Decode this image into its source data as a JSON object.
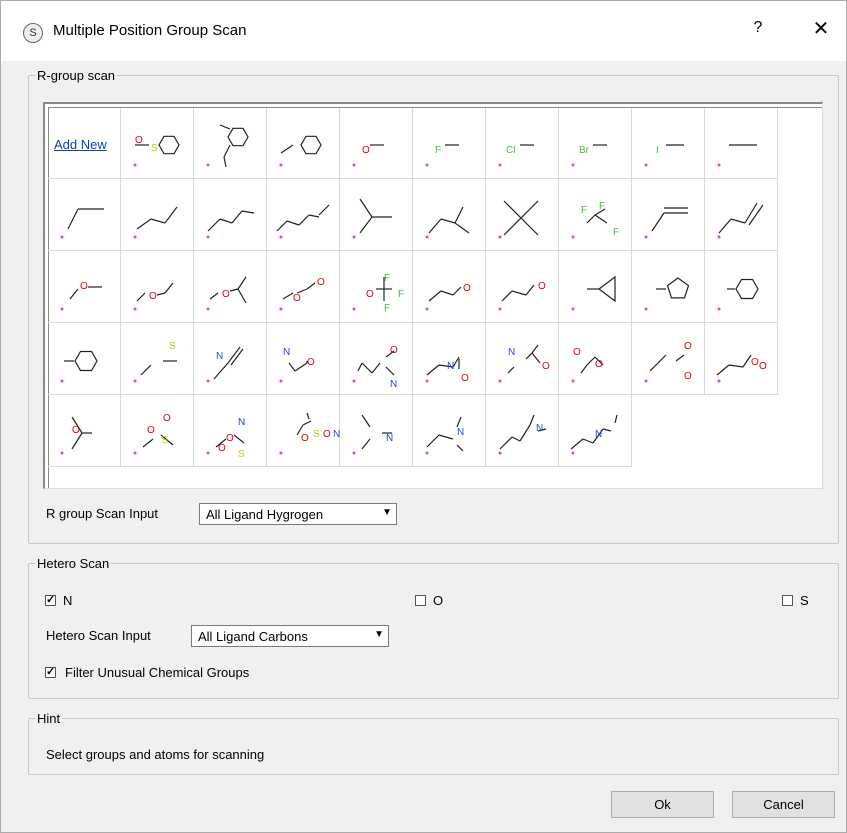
{
  "window": {
    "title": "Multiple Position Group Scan",
    "help": "?",
    "close": "✕",
    "app_icon": "S"
  },
  "rgroup": {
    "legend": "R-group scan",
    "add_new": "Add New",
    "scan_input_label": "R group Scan Input",
    "scan_input_value": "All Ligand Hygrogen",
    "cells": [
      {
        "name": "sulfonyl-phenyl",
        "labels": [
          {
            "t": "O",
            "c": "#e00000"
          },
          {
            "t": "S",
            "c": "#c8c800"
          }
        ]
      },
      {
        "name": "methyl-benzyl",
        "labels": []
      },
      {
        "name": "benzyl",
        "labels": []
      },
      {
        "name": "hydroxy",
        "labels": [
          {
            "t": "O",
            "c": "#e00000"
          }
        ]
      },
      {
        "name": "fluoro",
        "labels": [
          {
            "t": "F",
            "c": "#44bb44"
          }
        ]
      },
      {
        "name": "chloro",
        "labels": [
          {
            "t": "Cl",
            "c": "#44bb44"
          }
        ]
      },
      {
        "name": "bromo",
        "labels": [
          {
            "t": "Br",
            "c": "#44bb44"
          }
        ]
      },
      {
        "name": "iodo",
        "labels": [
          {
            "t": "I",
            "c": "#44bb44"
          }
        ]
      },
      {
        "name": "methyl",
        "labels": []
      },
      {
        "name": "ethyl",
        "labels": []
      },
      {
        "name": "propyl",
        "labels": []
      },
      {
        "name": "butyl",
        "labels": []
      },
      {
        "name": "pentyl",
        "labels": []
      },
      {
        "name": "isopropyl",
        "labels": []
      },
      {
        "name": "isobutyl",
        "labels": []
      },
      {
        "name": "tert-butyl",
        "labels": []
      },
      {
        "name": "trifluoromethyl",
        "labels": [
          {
            "t": "F",
            "c": "#44bb44"
          },
          {
            "t": "F",
            "c": "#44bb44"
          },
          {
            "t": "F",
            "c": "#44bb44"
          }
        ]
      },
      {
        "name": "vinyl",
        "labels": []
      },
      {
        "name": "allyl",
        "labels": []
      },
      {
        "name": "methoxy",
        "labels": [
          {
            "t": "O",
            "c": "#e00000"
          }
        ]
      },
      {
        "name": "ethoxy",
        "labels": [
          {
            "t": "O",
            "c": "#e00000"
          }
        ]
      },
      {
        "name": "isopropoxy",
        "labels": [
          {
            "t": "O",
            "c": "#e00000"
          }
        ]
      },
      {
        "name": "methoxymethoxy",
        "labels": [
          {
            "t": "O",
            "c": "#e00000"
          },
          {
            "t": "O",
            "c": "#e00000"
          }
        ]
      },
      {
        "name": "trifluoromethoxy",
        "labels": [
          {
            "t": "O",
            "c": "#e00000"
          },
          {
            "t": "F",
            "c": "#44bb44"
          },
          {
            "t": "F",
            "c": "#44bb44"
          },
          {
            "t": "F",
            "c": "#44bb44"
          }
        ]
      },
      {
        "name": "methoxymethyl",
        "labels": [
          {
            "t": "O",
            "c": "#e00000"
          }
        ]
      },
      {
        "name": "methoxyethyl",
        "labels": [
          {
            "t": "O",
            "c": "#e00000"
          }
        ]
      },
      {
        "name": "cyclopropyl",
        "labels": []
      },
      {
        "name": "cyclopentyl",
        "labels": []
      },
      {
        "name": "cyclohexyl",
        "labels": []
      },
      {
        "name": "phenyl",
        "labels": []
      },
      {
        "name": "methylthio",
        "labels": [
          {
            "t": "S",
            "c": "#c8c800"
          }
        ]
      },
      {
        "name": "cyanomethyl",
        "labels": [
          {
            "t": "N",
            "c": "#2244ee"
          }
        ]
      },
      {
        "name": "carbamoyl",
        "labels": [
          {
            "t": "N",
            "c": "#2244ee"
          },
          {
            "t": "O",
            "c": "#e00000"
          }
        ]
      },
      {
        "name": "dimethylcarbamoyl",
        "labels": [
          {
            "t": "O",
            "c": "#e00000"
          },
          {
            "t": "N",
            "c": "#2244ee"
          }
        ]
      },
      {
        "name": "carbamoylethyl",
        "labels": [
          {
            "t": "N",
            "c": "#2244ee"
          },
          {
            "t": "O",
            "c": "#e00000"
          }
        ]
      },
      {
        "name": "acetamido",
        "labels": [
          {
            "t": "N",
            "c": "#2244ee"
          },
          {
            "t": "O",
            "c": "#e00000"
          }
        ]
      },
      {
        "name": "carboxy",
        "labels": [
          {
            "t": "O",
            "c": "#e00000"
          },
          {
            "t": "O",
            "c": "#e00000"
          }
        ]
      },
      {
        "name": "methyl-ester",
        "labels": [
          {
            "t": "O",
            "c": "#e00000"
          },
          {
            "t": "O",
            "c": "#e00000"
          }
        ]
      },
      {
        "name": "carboxyethyl",
        "labels": [
          {
            "t": "O",
            "c": "#e00000"
          },
          {
            "t": "O",
            "c": "#e00000"
          }
        ]
      },
      {
        "name": "acetyl",
        "labels": [
          {
            "t": "O",
            "c": "#e00000"
          }
        ]
      },
      {
        "name": "methylsulfonyl",
        "labels": [
          {
            "t": "O",
            "c": "#e00000"
          },
          {
            "t": "O",
            "c": "#e00000"
          },
          {
            "t": "S",
            "c": "#c8c800"
          }
        ]
      },
      {
        "name": "sulfamoyl",
        "labels": [
          {
            "t": "O",
            "c": "#e00000"
          },
          {
            "t": "O",
            "c": "#e00000"
          },
          {
            "t": "S",
            "c": "#c8c800"
          },
          {
            "t": "N",
            "c": "#2244ee"
          }
        ]
      },
      {
        "name": "dimethylsulfamoyl",
        "labels": [
          {
            "t": "O",
            "c": "#e00000"
          },
          {
            "t": "S",
            "c": "#c8c800"
          },
          {
            "t": "O",
            "c": "#e00000"
          },
          {
            "t": "N",
            "c": "#2244ee"
          }
        ]
      },
      {
        "name": "dimethylamino",
        "labels": [
          {
            "t": "N",
            "c": "#2244ee"
          }
        ]
      },
      {
        "name": "dimethylaminomethyl",
        "labels": [
          {
            "t": "N",
            "c": "#2244ee"
          }
        ]
      },
      {
        "name": "dimethylaminoethyl",
        "labels": [
          {
            "t": "N",
            "c": "#2244ee"
          }
        ]
      },
      {
        "name": "dimethylaminopropyl",
        "labels": [
          {
            "t": "N",
            "c": "#2244ee"
          }
        ]
      }
    ]
  },
  "hetero": {
    "legend": "Hetero Scan",
    "n_label": "N",
    "n_checked": true,
    "o_label": "O",
    "o_checked": false,
    "s_label": "S",
    "s_checked": false,
    "scan_input_label": "Hetero Scan Input",
    "scan_input_value": "All Ligand Carbons",
    "filter_label": "Filter Unusual Chemical Groups",
    "filter_checked": true
  },
  "hint": {
    "legend": "Hint",
    "text": "Select groups and atoms for scanning"
  },
  "buttons": {
    "ok": "Ok",
    "cancel": "Cancel"
  },
  "colors": {
    "oxygen": "#e00000",
    "nitrogen": "#2244ee",
    "halogen": "#44bb44",
    "sulfur": "#c8c800",
    "attach": "#dd44dd",
    "link": "#0645ad"
  }
}
